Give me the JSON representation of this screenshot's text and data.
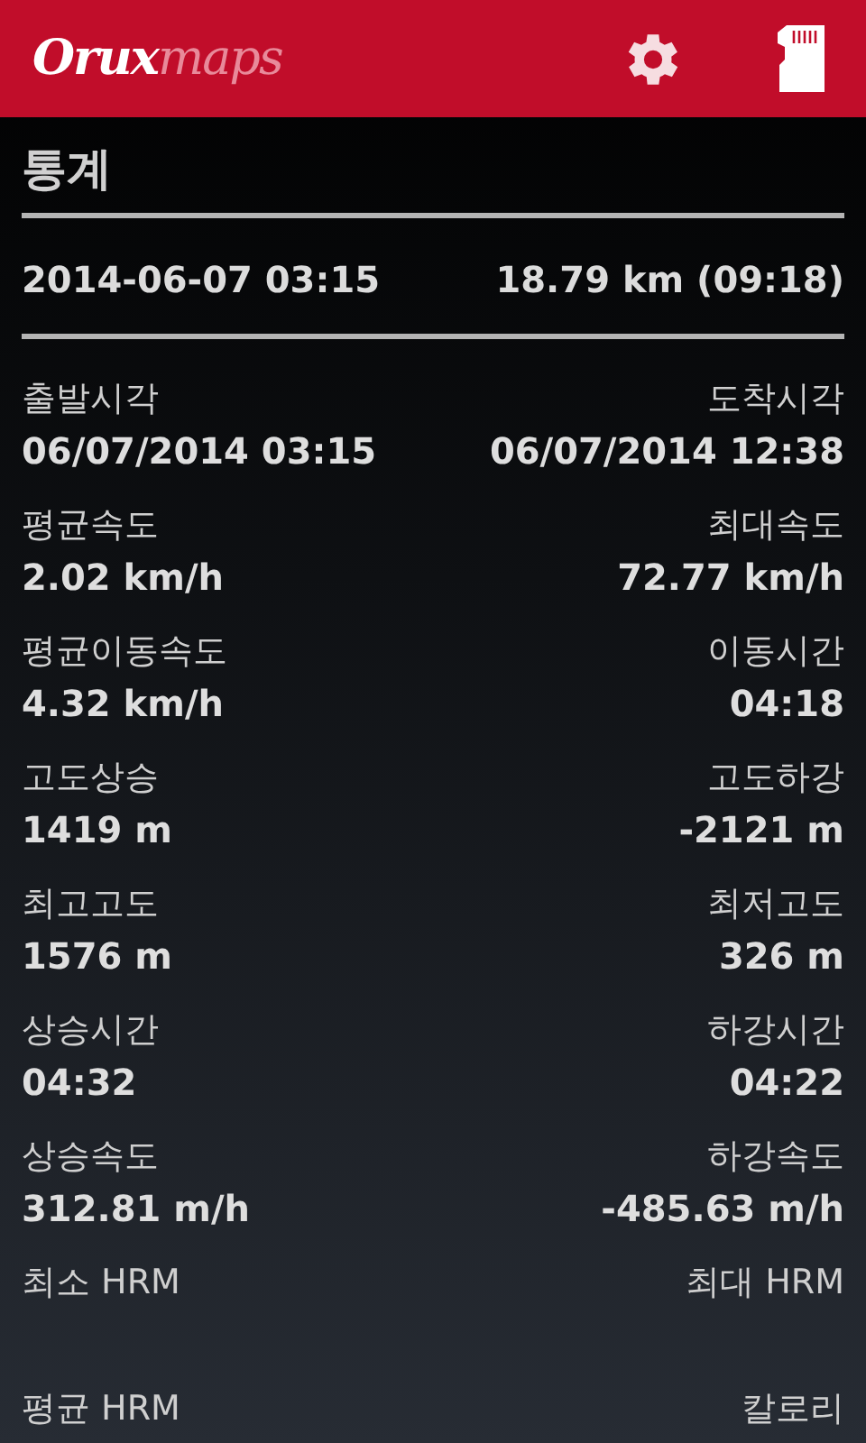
{
  "app_bar": {
    "logo": {
      "strong": "Orux",
      "light": "maps"
    }
  },
  "title": "통계",
  "summary": {
    "date": "2014-06-07 03:15",
    "distance": "18.79 km (09:18)"
  },
  "stats": [
    {
      "left": {
        "label": "출발시각",
        "value": "06/07/2014 03:15"
      },
      "right": {
        "label": "도착시각",
        "value": "06/07/2014 12:38"
      }
    },
    {
      "left": {
        "label": "평균속도",
        "value": "2.02 km/h"
      },
      "right": {
        "label": "최대속도",
        "value": "72.77 km/h"
      }
    },
    {
      "left": {
        "label": "평균이동속도",
        "value": "4.32 km/h"
      },
      "right": {
        "label": "이동시간",
        "value": "04:18"
      }
    },
    {
      "left": {
        "label": "고도상승",
        "value": "1419 m"
      },
      "right": {
        "label": "고도하강",
        "value": "-2121 m"
      }
    },
    {
      "left": {
        "label": "최고고도",
        "value": "1576 m"
      },
      "right": {
        "label": "최저고도",
        "value": "326 m"
      }
    },
    {
      "left": {
        "label": "상승시간",
        "value": "04:32"
      },
      "right": {
        "label": "하강시간",
        "value": "04:22"
      }
    },
    {
      "left": {
        "label": "상승속도",
        "value": "312.81 m/h"
      },
      "right": {
        "label": "하강속도",
        "value": "-485.63 m/h"
      }
    },
    {
      "left": {
        "label": "최소 HRM"
      },
      "right": {
        "label": "최대 HRM"
      }
    },
    {
      "left": {
        "label": "평균 HRM"
      },
      "right": {
        "label": "칼로리"
      }
    }
  ]
}
